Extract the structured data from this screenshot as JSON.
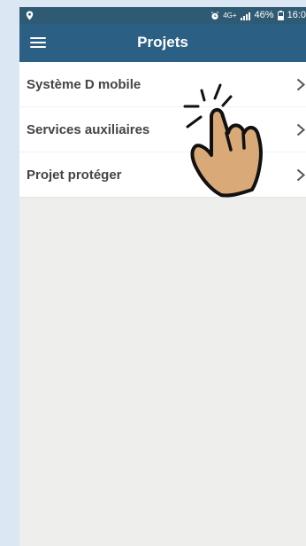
{
  "status_bar": {
    "network": "4G+",
    "battery": "46%",
    "time": "16:0"
  },
  "app_bar": {
    "title": "Projets"
  },
  "projects": [
    {
      "label": "Système D mobile"
    },
    {
      "label": "Services auxiliaires"
    },
    {
      "label": "Projet protéger"
    }
  ],
  "icons": {
    "menu": "menu-icon",
    "chevron": "chevron-right-icon",
    "pointer": "pointing-hand-icon"
  },
  "colors": {
    "status_bar": "#2f5a73",
    "app_bar": "#2b6084",
    "background": "#eeeeec",
    "page_background": "#dbe8f4",
    "text": "#444444",
    "hand": "#d9a978"
  }
}
